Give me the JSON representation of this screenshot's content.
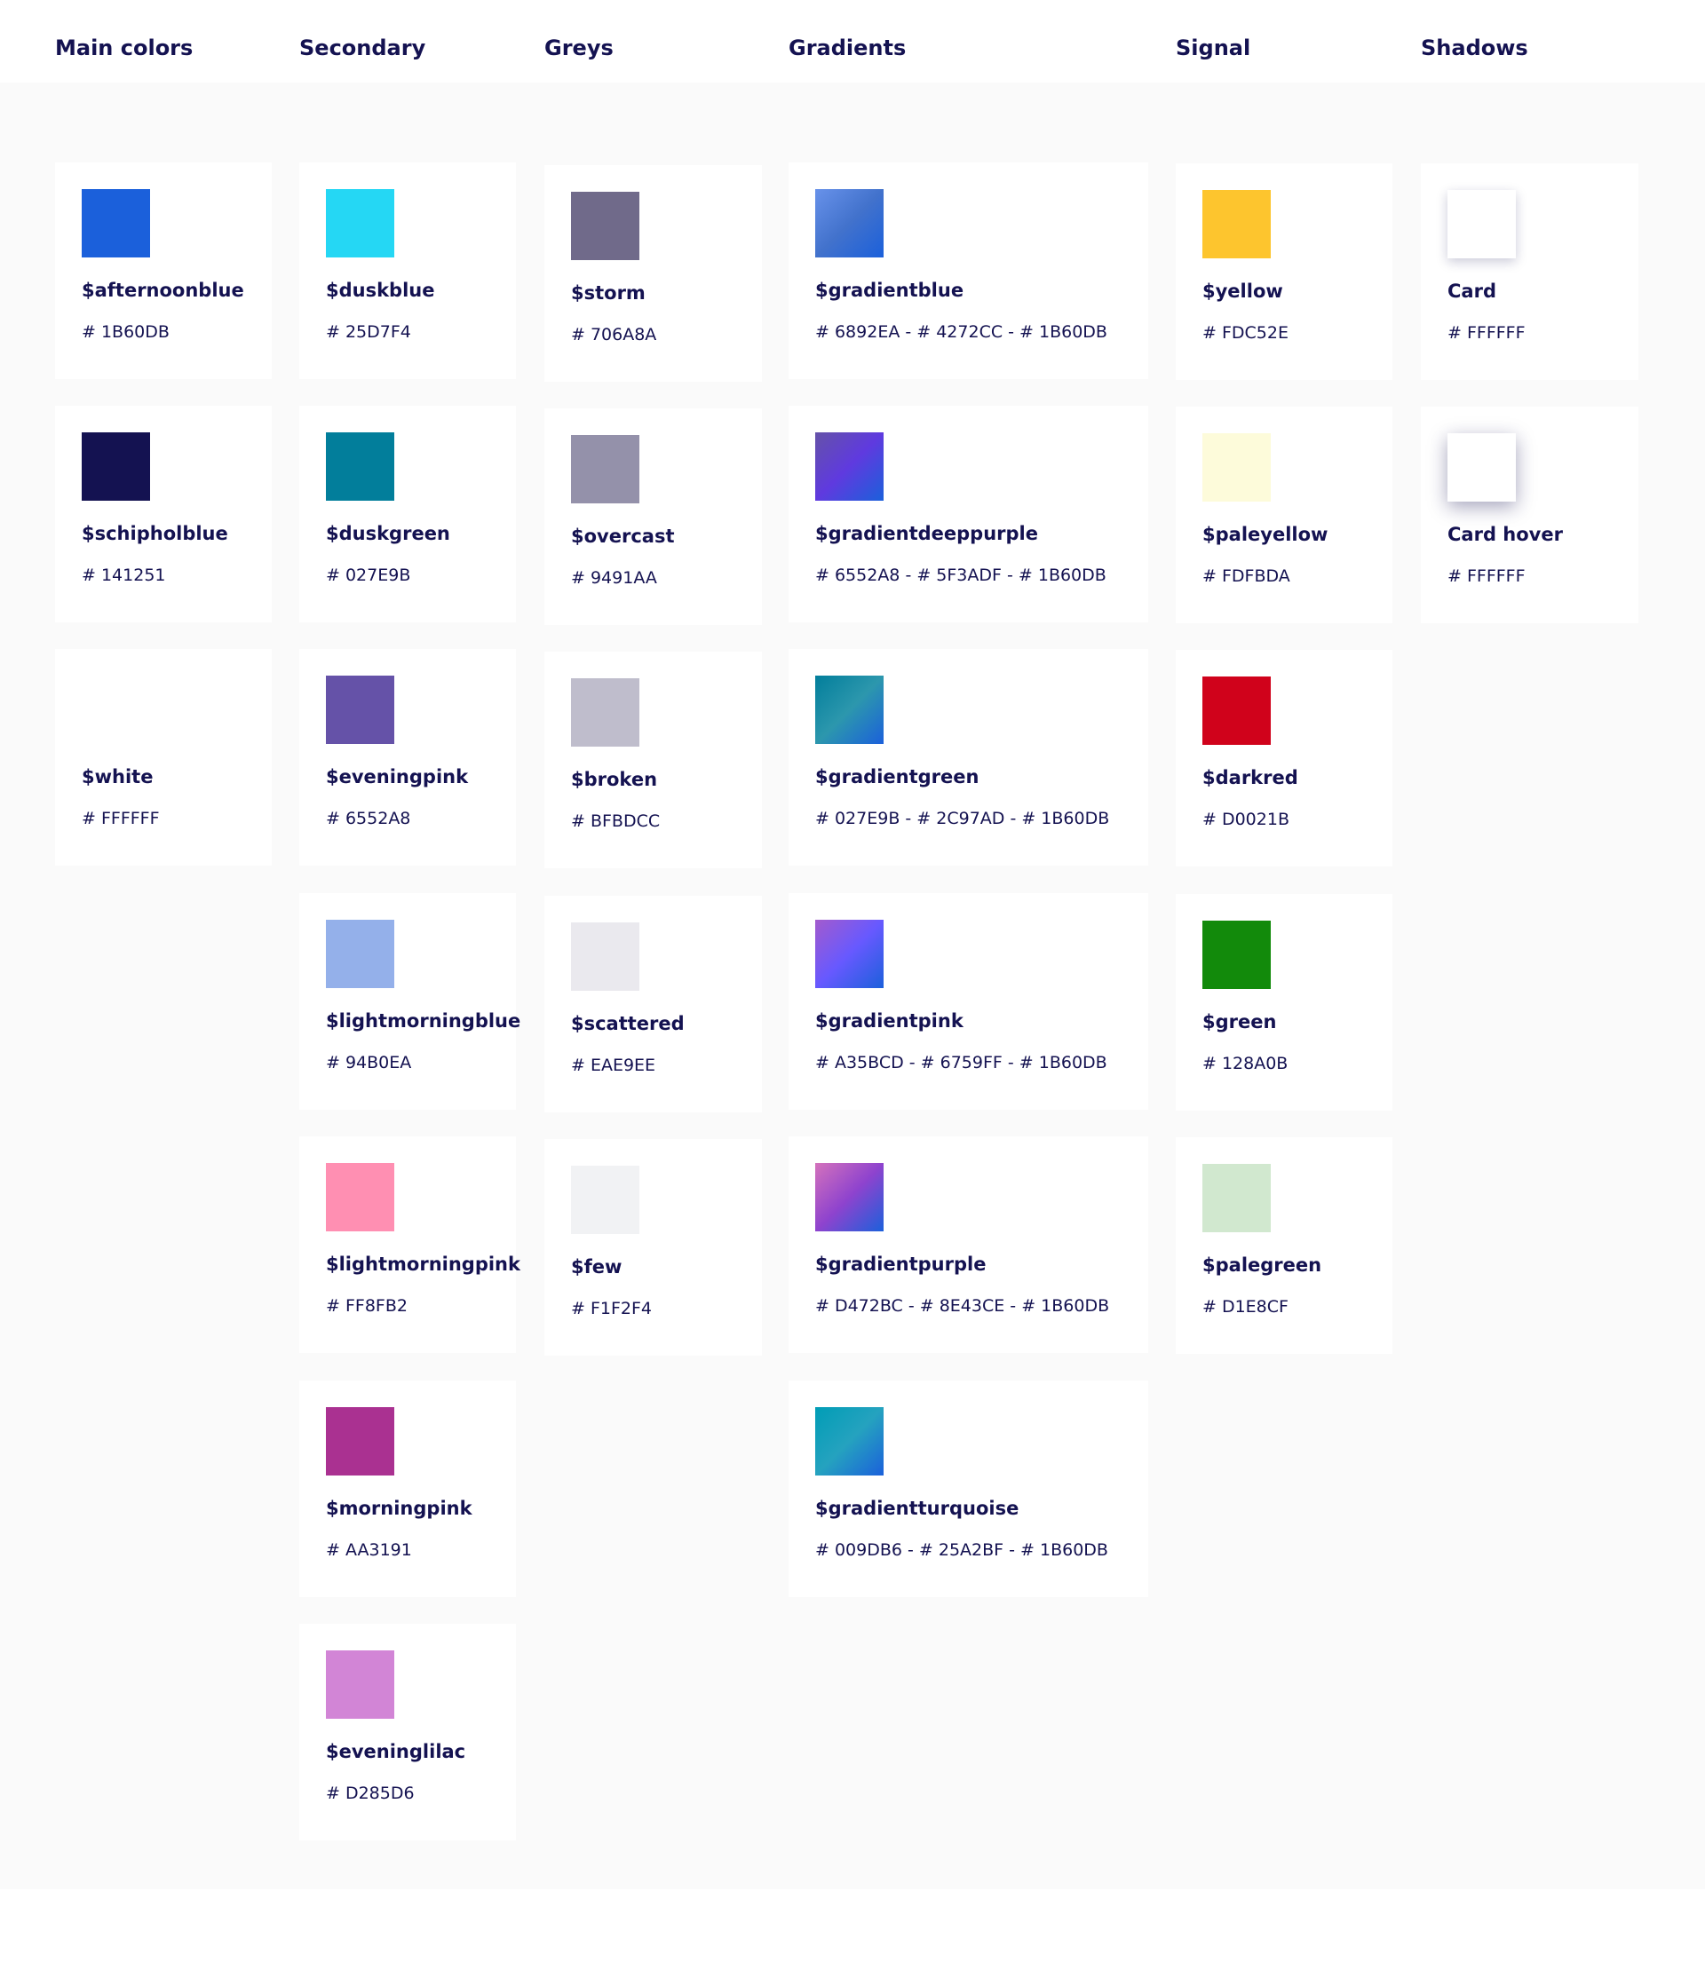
{
  "columns": [
    {
      "title": "Main colors",
      "items": [
        {
          "name": "$afternoonblue",
          "hex": "# 1B60DB",
          "color": "#1B60DB"
        },
        {
          "name": "$schipholblue",
          "hex": "# 141251",
          "color": "#141251"
        },
        {
          "name": "$white",
          "hex": "# FFFFFF",
          "color": "#FFFFFF"
        }
      ]
    },
    {
      "title": "Secondary",
      "items": [
        {
          "name": "$duskblue",
          "hex": "# 25D7F4",
          "color": "#25D7F4"
        },
        {
          "name": "$duskgreen",
          "hex": "# 027E9B",
          "color": "#027E9B"
        },
        {
          "name": "$eveningpink",
          "hex": "# 6552A8",
          "color": "#6552A8"
        },
        {
          "name": "$lightmorningblue",
          "hex": "# 94B0EA",
          "color": "#94B0EA"
        },
        {
          "name": "$lightmorningpink",
          "hex": "# FF8FB2",
          "color": "#FF8FB2"
        },
        {
          "name": "$morningpink",
          "hex": "# AA3191",
          "color": "#AA3191"
        },
        {
          "name": "$eveninglilac",
          "hex": "# D285D6",
          "color": "#D285D6"
        }
      ]
    },
    {
      "title": "Greys",
      "items": [
        {
          "name": "$storm",
          "hex": "# 706A8A",
          "color": "#706A8A"
        },
        {
          "name": "$overcast",
          "hex": "# 9491AA",
          "color": "#9491AA"
        },
        {
          "name": "$broken",
          "hex": "# BFBDCC",
          "color": "#BFBDCC"
        },
        {
          "name": "$scattered",
          "hex": "# EAE9EE",
          "color": "#EAE9EE"
        },
        {
          "name": "$few",
          "hex": "# F1F2F4",
          "color": "#F1F2F4"
        }
      ]
    },
    {
      "title": "Gradients",
      "items": [
        {
          "name": "$gradientblue",
          "hex": "# 6892EA  -  # 4272CC - # 1B60DB",
          "stops": [
            "#6892EA",
            "#4272CC",
            "#1B60DB"
          ]
        },
        {
          "name": "$gradientdeeppurple",
          "hex": "# 6552A8  -  # 5F3ADF - # 1B60DB",
          "stops": [
            "#6552A8",
            "#5F3ADF",
            "#1B60DB"
          ]
        },
        {
          "name": "$gradientgreen",
          "hex": "# 027E9B  -  # 2C97AD - # 1B60DB",
          "stops": [
            "#027E9B",
            "#2C97AD",
            "#1B60DB"
          ]
        },
        {
          "name": "$gradientpink",
          "hex": "# A35BCD  -  # 6759FF - # 1B60DB",
          "stops": [
            "#A35BCD",
            "#6759FF",
            "#1B60DB"
          ]
        },
        {
          "name": "$gradientpurple",
          "hex": "# D472BC  -  # 8E43CE - # 1B60DB",
          "stops": [
            "#D472BC",
            "#8E43CE",
            "#1B60DB"
          ]
        },
        {
          "name": "$gradientturquoise",
          "hex": "# 009DB6  -  # 25A2BF - # 1B60DB",
          "stops": [
            "#009DB6",
            "#25A2BF",
            "#1B60DB"
          ]
        }
      ]
    },
    {
      "title": "Signal",
      "items": [
        {
          "name": "$yellow",
          "hex": "# FDC52E",
          "color": "#FDC52E"
        },
        {
          "name": "$paleyellow",
          "hex": "# FDFBDA",
          "color": "#FDFBDA"
        },
        {
          "name": "$darkred",
          "hex": "# D0021B",
          "color": "#D0021B"
        },
        {
          "name": "$green",
          "hex": "# 128A0B",
          "color": "#128A0B"
        },
        {
          "name": "$palegreen",
          "hex": "# D1E8CF",
          "color": "#D1E8CF"
        }
      ]
    },
    {
      "title": "Shadows",
      "items": [
        {
          "name": "Card",
          "hex": "# FFFFFF",
          "color": "#FFFFFF",
          "shadow": "card"
        },
        {
          "name": "Card hover",
          "hex": "# FFFFFF",
          "color": "#FFFFFF",
          "shadow": "hover"
        }
      ]
    }
  ]
}
